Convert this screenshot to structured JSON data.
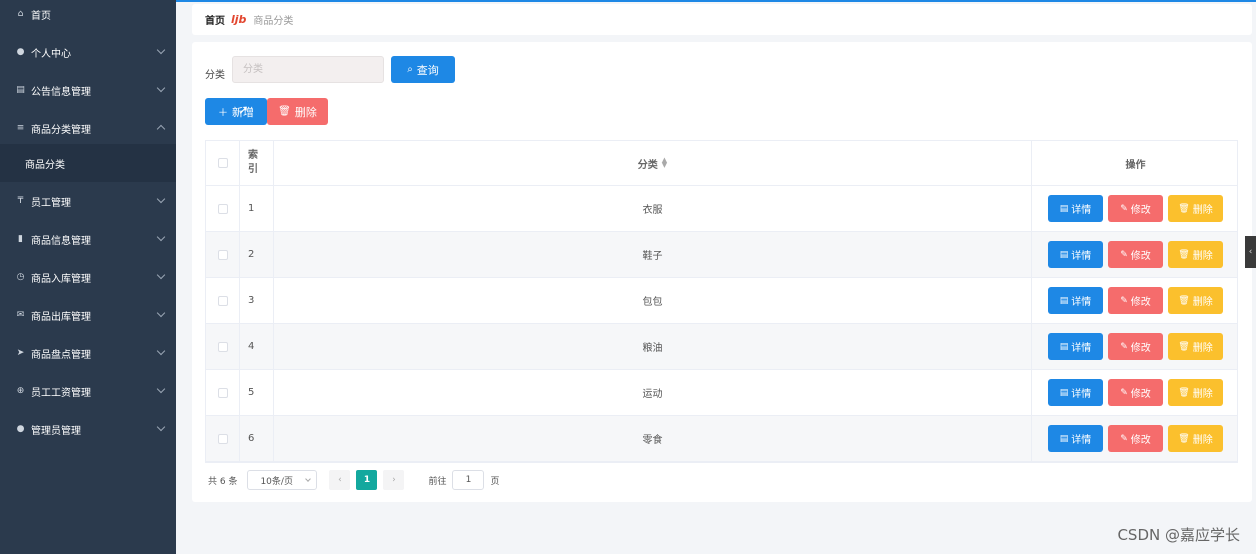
{
  "sidebar": {
    "items": [
      {
        "label": "首页",
        "icon": "home-icon",
        "glyph": "⌂",
        "expandable": false
      },
      {
        "label": "个人中心",
        "icon": "user-icon",
        "glyph": "●",
        "expandable": true
      },
      {
        "label": "公告信息管理",
        "icon": "document-icon",
        "glyph": "▤",
        "expandable": true
      },
      {
        "label": "商品分类管理",
        "icon": "menu-icon",
        "glyph": "≡",
        "expandable": true,
        "open": true
      },
      {
        "label": "员工管理",
        "icon": "stamp-icon",
        "glyph": "₸",
        "expandable": true
      },
      {
        "label": "商品信息管理",
        "icon": "bar-chart-icon",
        "glyph": "▮",
        "expandable": true
      },
      {
        "label": "商品入库管理",
        "icon": "compass-icon",
        "glyph": "◷",
        "expandable": true
      },
      {
        "label": "商品出库管理",
        "icon": "mail-icon",
        "glyph": "✉",
        "expandable": true
      },
      {
        "label": "商品盘点管理",
        "icon": "send-icon",
        "glyph": "➤",
        "expandable": true
      },
      {
        "label": "员工工资管理",
        "icon": "globe-icon",
        "glyph": "⊕",
        "expandable": true
      },
      {
        "label": "管理员管理",
        "icon": "admin-icon",
        "glyph": "●",
        "expandable": true
      }
    ],
    "submenu": {
      "label": "商品分类"
    }
  },
  "breadcrumb": {
    "home": "首页",
    "separator": "ljb",
    "current": "商品分类"
  },
  "search": {
    "label": "分类",
    "placeholder": "分类",
    "query_button": "查询"
  },
  "toolbar": {
    "add_button": "新增",
    "delete_button": "删除"
  },
  "table": {
    "headers": {
      "index": "索引",
      "category": "分类",
      "actions": "操作"
    },
    "rows": [
      {
        "index": "1",
        "category": "衣服"
      },
      {
        "index": "2",
        "category": "鞋子"
      },
      {
        "index": "3",
        "category": "包包"
      },
      {
        "index": "4",
        "category": "粮油"
      },
      {
        "index": "5",
        "category": "运动"
      },
      {
        "index": "6",
        "category": "零食"
      }
    ],
    "row_actions": {
      "detail": "详情",
      "edit": "修改",
      "delete": "删除"
    }
  },
  "pagination": {
    "total_text": "共 6 条",
    "page_size": "10条/页",
    "current_page": "1",
    "goto_label": "前往",
    "goto_value": "1",
    "page_suffix": "页"
  },
  "watermark": "CSDN @嘉应学长",
  "colors": {
    "sidebar_bg": "#2b3a4d",
    "primary": "#1e88e5",
    "danger": "#f56c6c",
    "warning": "#fbc02d",
    "pager_active": "#13a89e"
  }
}
